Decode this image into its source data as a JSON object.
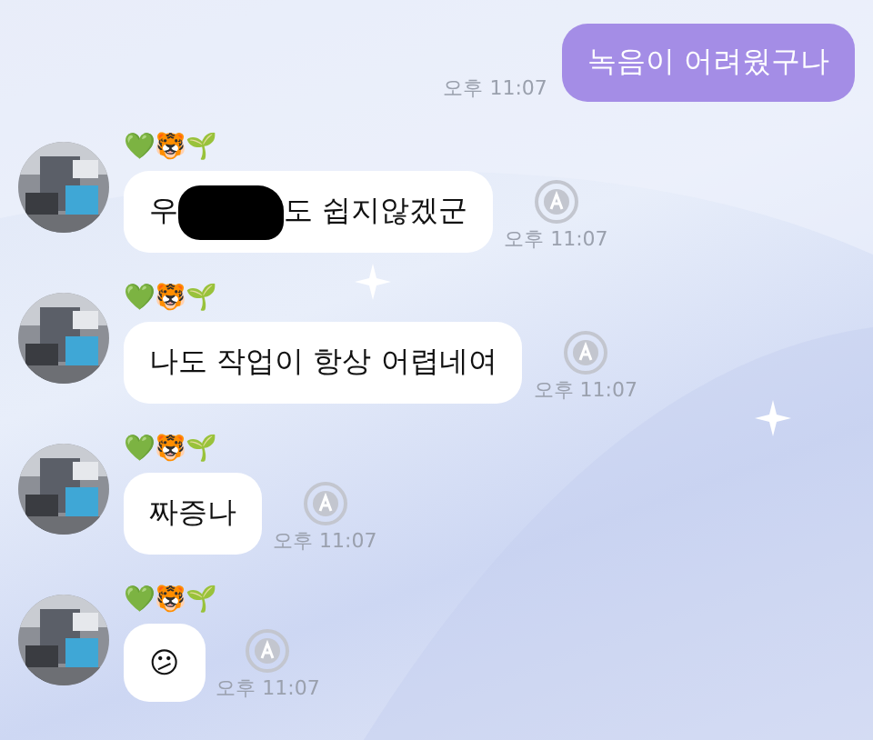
{
  "messages": [
    {
      "kind": "outgoing",
      "text": "녹음이 어려웠구나",
      "time": "오후 11:07"
    },
    {
      "kind": "incoming",
      "sender": "💚🐯🌱",
      "parts": [
        {
          "kind": "text",
          "text": "우"
        },
        {
          "kind": "redaction"
        },
        {
          "kind": "text",
          "text": "도 쉽지않겠군"
        }
      ],
      "time": "오후 11:07"
    },
    {
      "kind": "incoming",
      "sender": "💚🐯🌱",
      "parts": [
        {
          "kind": "text",
          "text": "나도 작업이 항상 어렵네여"
        }
      ],
      "time": "오후 11:07"
    },
    {
      "kind": "incoming",
      "sender": "💚🐯🌱",
      "parts": [
        {
          "kind": "text",
          "text": "짜증나"
        }
      ],
      "time": "오후 11:07"
    },
    {
      "kind": "incoming",
      "sender": "💚🐯🌱",
      "parts": [
        {
          "kind": "text",
          "text": "😕"
        }
      ],
      "time": "오후 11:07"
    }
  ]
}
